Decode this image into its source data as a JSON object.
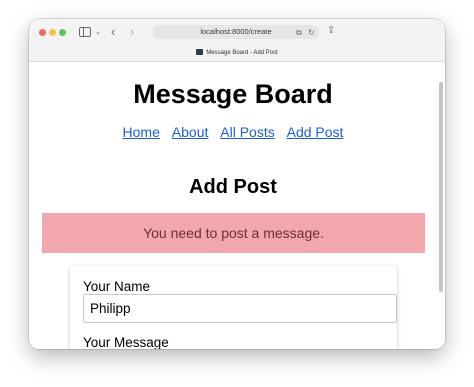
{
  "browser": {
    "url": "localhost:8000/create",
    "tab_title": "Message Board - Add Post",
    "icons": [
      "sidebar-icon",
      "chevron-down-icon",
      "back-icon",
      "forward-icon",
      "translate-icon",
      "reload-icon",
      "share-icon"
    ]
  },
  "page": {
    "title": "Message Board",
    "nav": [
      {
        "label": "Home"
      },
      {
        "label": "About"
      },
      {
        "label": "All Posts"
      },
      {
        "label": "Add Post"
      }
    ],
    "section_title": "Add Post",
    "alert": {
      "message": "You need to post a message.",
      "color": "#f2a7ac"
    },
    "form": {
      "name_label": "Your Name",
      "name_value": "Philipp",
      "message_label": "Your Message",
      "message_value": ""
    }
  },
  "colors": {
    "link": "#1a5fd6",
    "alert_background": "#f2a7ac",
    "alert_text": "#6d2f36"
  }
}
